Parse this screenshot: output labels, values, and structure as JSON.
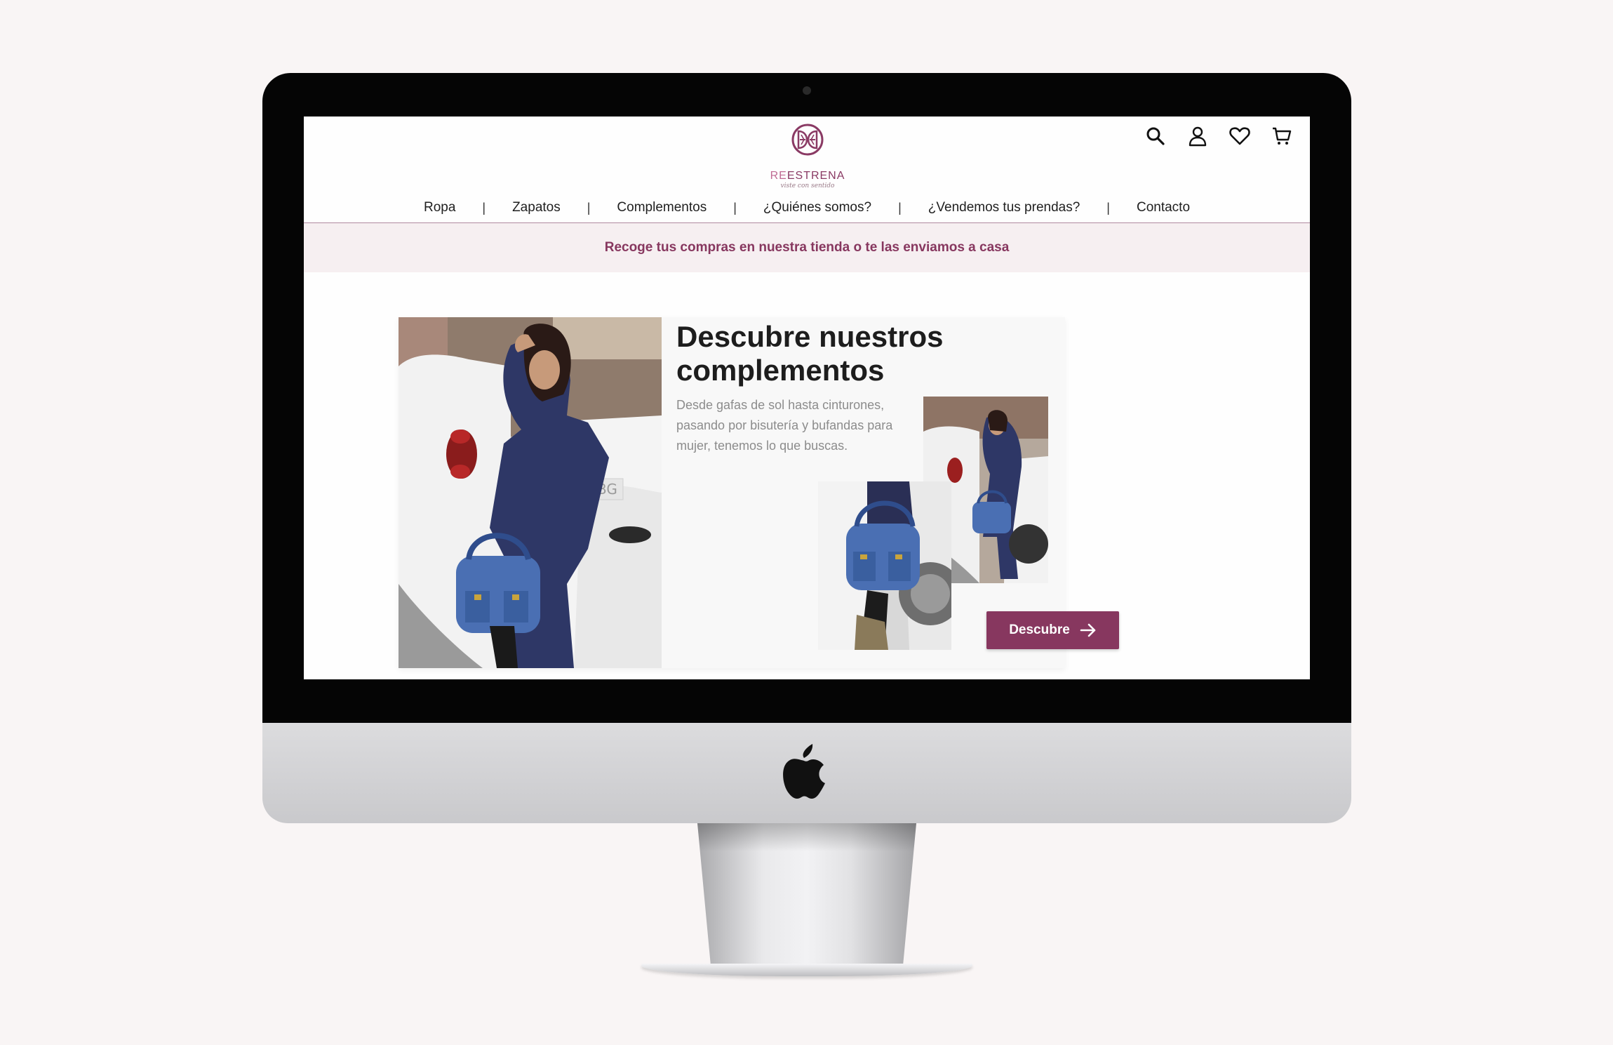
{
  "brand": {
    "name_re": "RE",
    "name_rest": "ESTRENA",
    "tagline": "viste con sentido",
    "color": "#87375f"
  },
  "header": {
    "icons": [
      "search-icon",
      "user-icon",
      "heart-icon",
      "cart-icon"
    ]
  },
  "nav": {
    "items": [
      {
        "label": "Ropa"
      },
      {
        "label": "Zapatos"
      },
      {
        "label": "Complementos"
      },
      {
        "label": "¿Quiénes somos?"
      },
      {
        "label": "¿Vendemos tus prendas?"
      },
      {
        "label": "Contacto"
      }
    ],
    "separator": "|"
  },
  "banner": {
    "text": "Recoge tus compras en nuestra tienda o te las enviamos a casa"
  },
  "hero": {
    "title": "Descubre nuestros complementos",
    "description": "Desde gafas de sol hasta cinturones, pasando por bisutería y bufandas para mujer, tenemos lo que buscas.",
    "cta_label": "Descubre"
  },
  "photo_plate_text": "HBG"
}
